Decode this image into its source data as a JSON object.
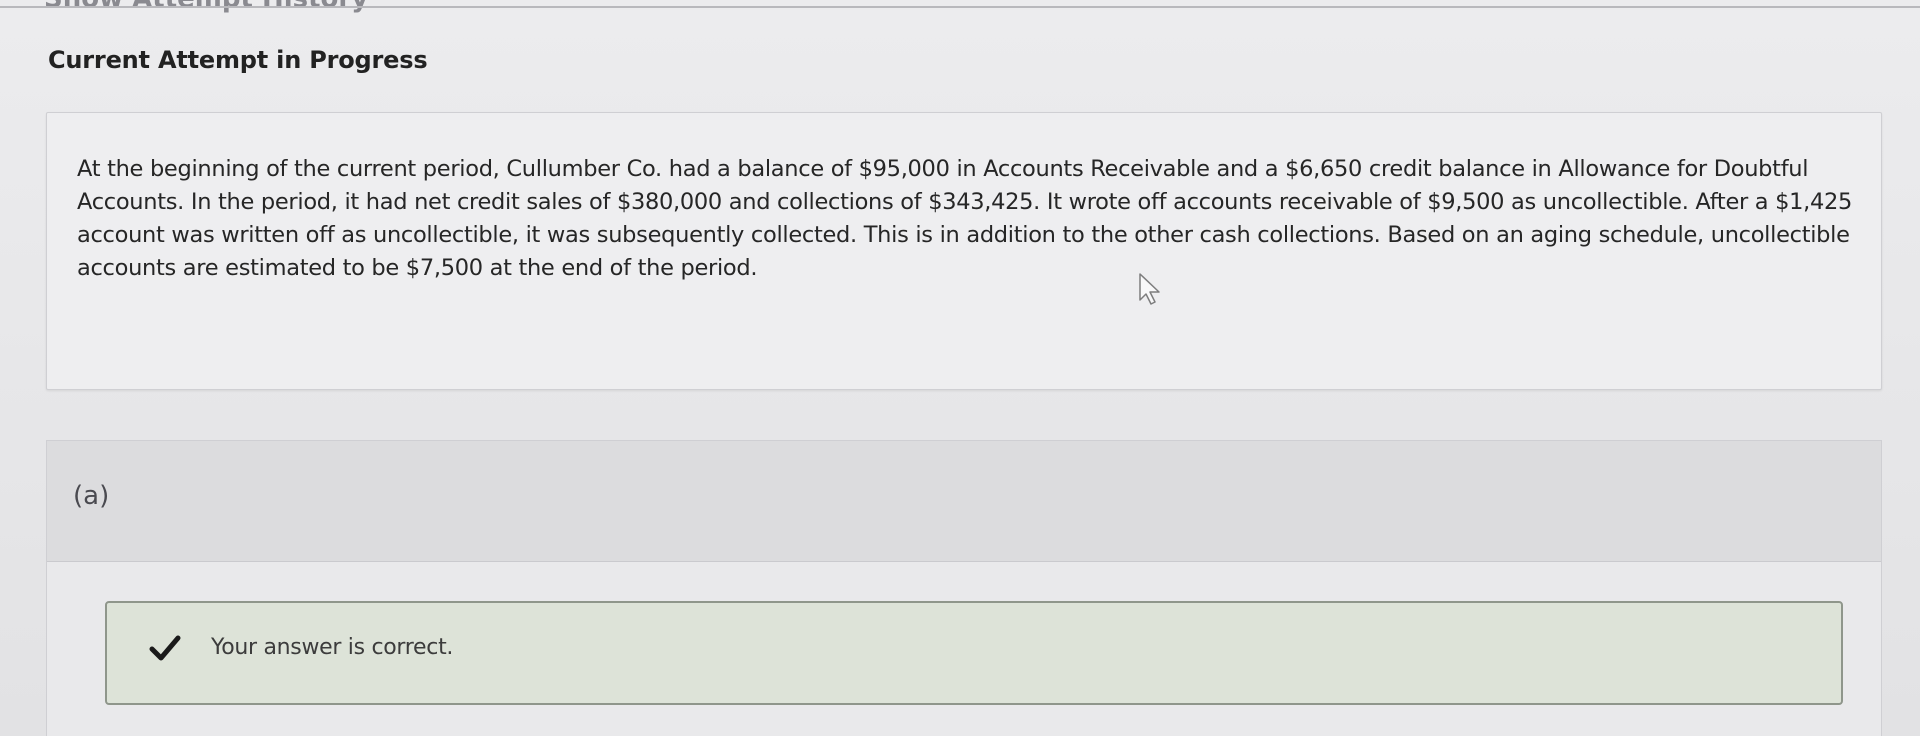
{
  "header": {
    "history_link": "Show Attempt History",
    "attempt_title": "Current Attempt in Progress"
  },
  "question": {
    "text": "At the beginning of the current period, Cullumber Co. had a balance of $95,000 in Accounts Receivable and a $6,650 credit balance in Allowance for Doubtful Accounts. In the period, it had net credit sales of $380,000 and collections of $343,425. It wrote off accounts receivable of $9,500 as uncollectible. After a $1,425 account was written off as uncollectible, it was subsequently collected. This is in addition to the other cash collections. Based on an aging schedule, uncollectible accounts are estimated to be $7,500 at the end of the period."
  },
  "part": {
    "label": "(a)",
    "feedback": "Your answer is correct.",
    "feedback_icon": "checkmark-icon",
    "feedback_color": "#dde3d8"
  },
  "icons": {
    "cursor": "mouse-cursor-icon"
  }
}
